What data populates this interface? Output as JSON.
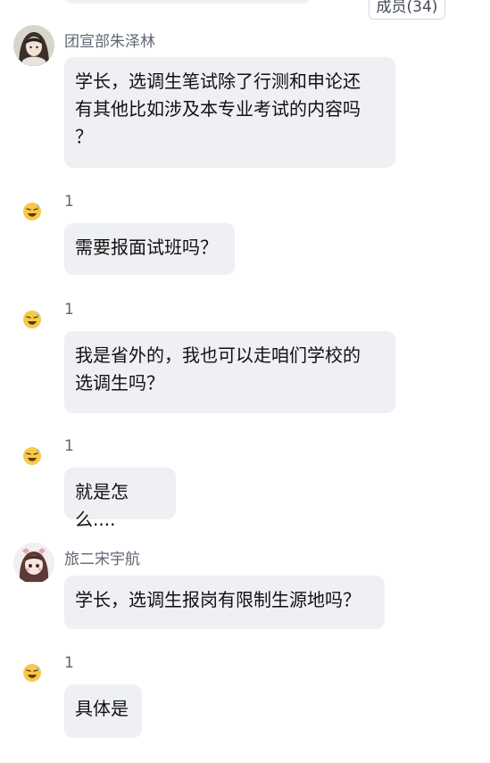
{
  "header": {
    "members_label": "成员(34)"
  },
  "messages": [
    {
      "sender": "团宣部朱泽林",
      "avatar_icon": "anime-girl-avatar-icon",
      "text": "学长，选调生笔试除了行测和申论还\n有其他比如涉及本专业考试的内容吗\n？"
    },
    {
      "sender": "1",
      "avatar_icon": "sweat-smile-emoji-icon",
      "text": "需要报面试班吗？"
    },
    {
      "sender": "1",
      "avatar_icon": "sweat-smile-emoji-icon",
      "text": "我是省外的，我也可以走咱们学校的\n选调生吗？"
    },
    {
      "sender": "1",
      "avatar_icon": "sweat-smile-emoji-icon",
      "text": "就是怎么...."
    },
    {
      "sender": "旅二宋宇航",
      "avatar_icon": "cartoon-girl-avatar-icon",
      "text": "学长，选调生报岗有限制生源地吗？"
    },
    {
      "sender": "1",
      "avatar_icon": "sweat-smile-emoji-icon",
      "text": "具体是"
    }
  ],
  "colors": {
    "bubble_bg": "#eef0f4",
    "sender_text": "#5f6672",
    "message_text": "#111111"
  }
}
